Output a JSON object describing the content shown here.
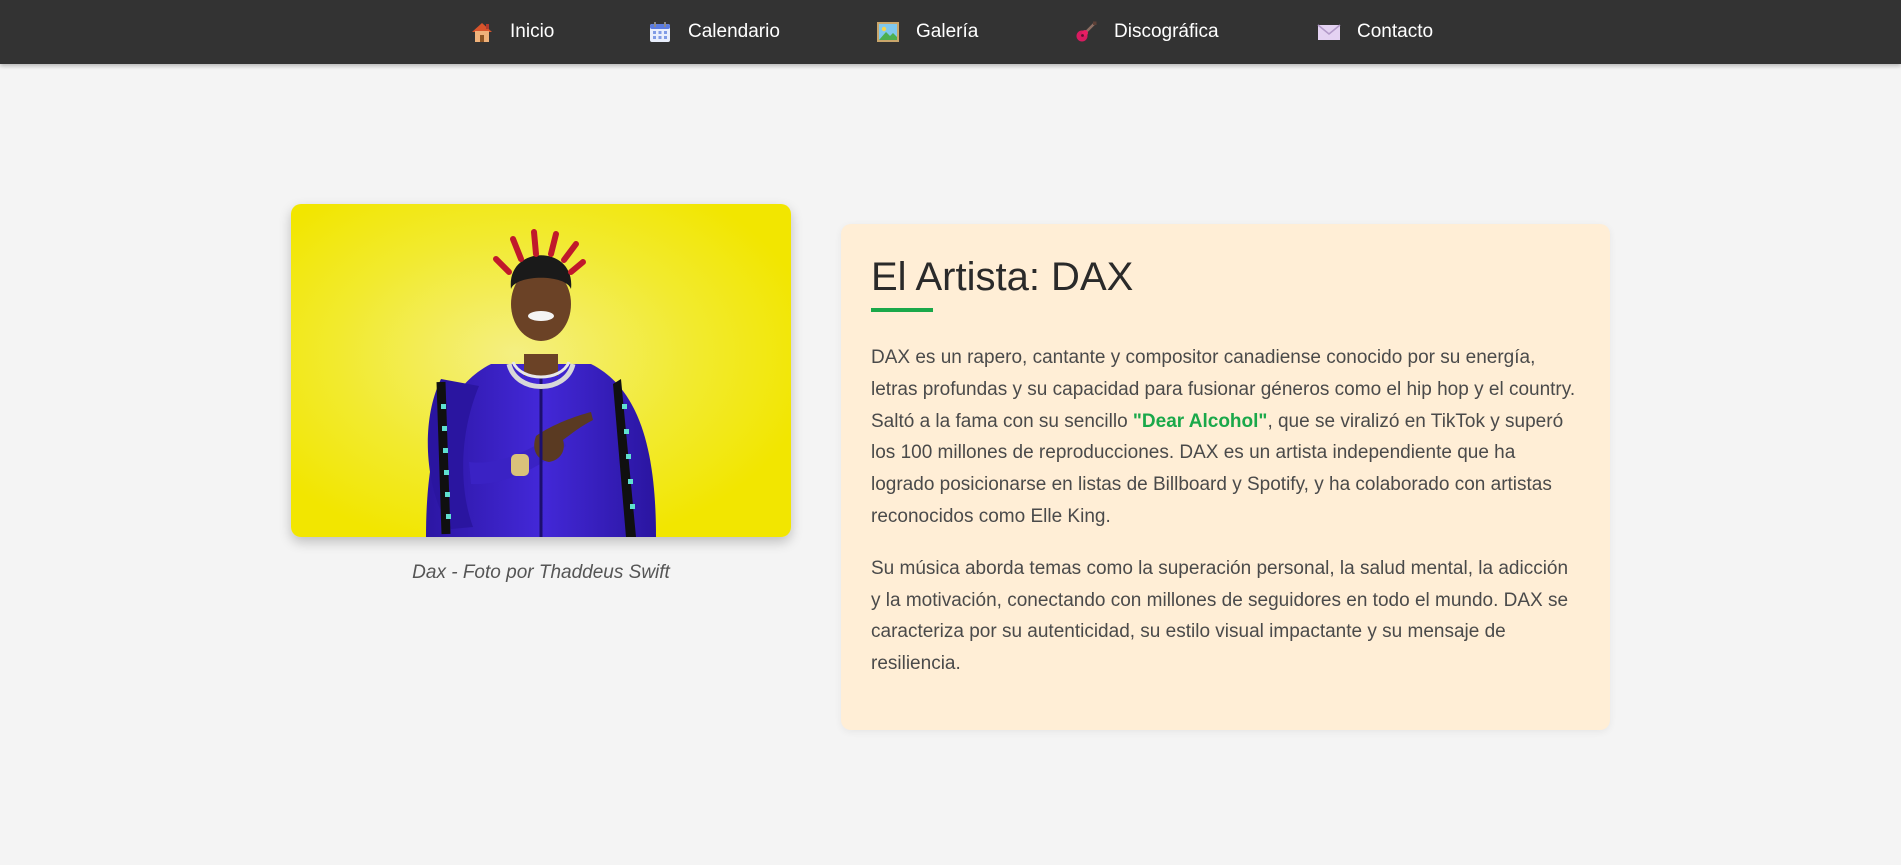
{
  "nav": {
    "items": [
      {
        "label": "Inicio",
        "icon": "house-icon"
      },
      {
        "label": "Calendario",
        "icon": "calendar-icon"
      },
      {
        "label": "Galería",
        "icon": "picture-icon"
      },
      {
        "label": "Discográfica",
        "icon": "guitar-icon"
      },
      {
        "label": "Contacto",
        "icon": "envelope-icon"
      }
    ]
  },
  "photo": {
    "caption": "Dax - Foto por Thaddeus Swift"
  },
  "artist": {
    "title": "El Artista: DAX",
    "p1_before": "DAX es un rapero, cantante y compositor canadiense conocido por su energía, letras profundas y su capacidad para fusionar géneros como el hip hop y el country. Saltó a la fama con su sencillo ",
    "p1_highlight": "\"Dear Alcohol\"",
    "p1_after": ", que se viralizó en TikTok y superó los 100 millones de reproducciones. DAX es un artista independiente que ha logrado posicionarse en listas de Billboard y Spotify, y ha colaborado con artistas reconocidos como Elle King.",
    "p2": "Su música aborda temas como la superación personal, la salud mental, la adicción y la motivación, conectando con millones de seguidores en todo el mundo. DAX se caracteriza por su autenticidad, su estilo visual impactante y su mensaje de resiliencia."
  },
  "colors": {
    "navbar": "#333333",
    "background": "#f4f4f4",
    "card": "#ffeed6",
    "accent": "#1aa84a",
    "photo_background": "#f2e600",
    "jacket": "#3d22c8"
  }
}
